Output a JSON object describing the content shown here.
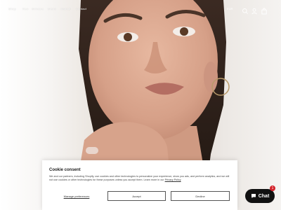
{
  "nav": {
    "links": [
      "Shop",
      "New",
      "Skincare",
      "Brand",
      "Journal",
      "Contact"
    ],
    "currency": "EUR",
    "icons": [
      "search-icon",
      "user-icon",
      "bag-icon"
    ]
  },
  "cookie": {
    "title": "Cookie consent",
    "body": "We and our partners, including Shopify, use cookies and other technologies to personalize your experience, show you ads, and perform analytics, and we will not use cookies or other technologies for these purposes unless you accept them. Learn more in our ",
    "privacy_link": "Privacy Policy",
    "manage_label": "Manage preferences",
    "accept_label": "Accept",
    "decline_label": "Decline"
  },
  "chat": {
    "label": "Chat",
    "badge": "1"
  },
  "colors": {
    "accent": "#111111",
    "badge": "#d3222a"
  }
}
